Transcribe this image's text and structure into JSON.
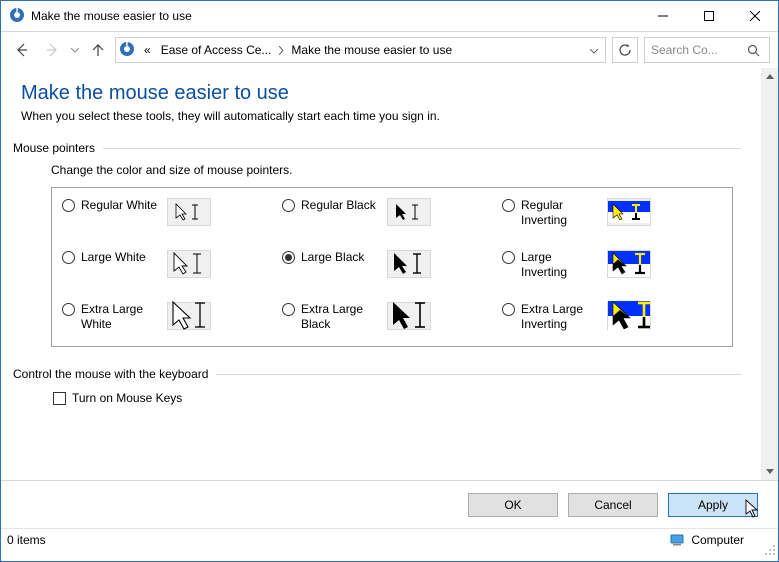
{
  "window": {
    "title": "Make the mouse easier to use"
  },
  "breadcrumb": {
    "seg1": "Ease of Access Ce...",
    "seg2": "Make the mouse easier to use",
    "prefix": "«"
  },
  "search": {
    "placeholder": "Search Co..."
  },
  "page": {
    "title": "Make the mouse easier to use",
    "subtitle": "When you select these tools, they will automatically start each time you sign in."
  },
  "pointers": {
    "heading": "Mouse pointers",
    "desc": "Change the color and size of mouse pointers.",
    "options": {
      "regular_white": "Regular White",
      "regular_black": "Regular Black",
      "regular_inverting": "Regular Inverting",
      "large_white": "Large White",
      "large_black": "Large Black",
      "large_inverting": "Large Inverting",
      "xlarge_white": "Extra Large White",
      "xlarge_black": "Extra Large Black",
      "xlarge_inverting": "Extra Large Inverting"
    },
    "selected": "large_black"
  },
  "keyboard_mouse": {
    "heading": "Control the mouse with the keyboard",
    "mousekeys_label": "Turn on Mouse Keys",
    "mousekeys_checked": false
  },
  "buttons": {
    "ok": "OK",
    "cancel": "Cancel",
    "apply": "Apply"
  },
  "status": {
    "items": "0 items",
    "location": "Computer"
  }
}
